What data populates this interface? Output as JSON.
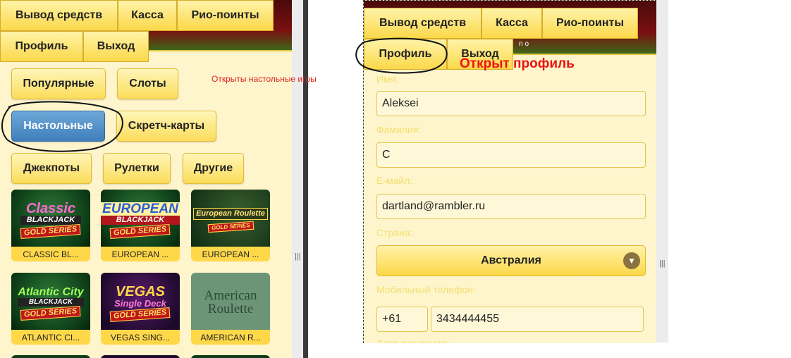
{
  "left": {
    "header": {
      "row1": [
        "Вывод средств",
        "Касса",
        "Рио-поинты"
      ],
      "row2": [
        "Профиль",
        "Выход"
      ],
      "logo_fragment": "no"
    },
    "categories": [
      "Популярные",
      "Слоты",
      "Настольные",
      "Скретч-карты",
      "Джекпоты",
      "Рулетки",
      "Другие"
    ],
    "active_category": "Настольные",
    "games": [
      {
        "caption": "CLASSIC BL...",
        "logo_top": "Classic",
        "logo_mid": "BLACKJACK",
        "badge": "GOLD SERIES",
        "icon": "classic-blackjack-thumbnail-icon"
      },
      {
        "caption": "EUROPEAN ...",
        "logo_top": "EUROPEAN",
        "logo_mid": "BLACKJACK",
        "badge": "GOLD SERIES",
        "icon": "european-blackjack-thumbnail-icon"
      },
      {
        "caption": "EUROPEAN ...",
        "logo_top": "European Roulette",
        "logo_mid": "",
        "badge": "GOLD SERIES",
        "icon": "european-roulette-thumbnail-icon"
      },
      {
        "caption": "ATLANTIC CI...",
        "logo_top": "Atlantic City",
        "logo_mid": "BLACKJACK",
        "badge": "GOLD SERIES",
        "icon": "atlantic-city-blackjack-thumbnail-icon"
      },
      {
        "caption": "VEGAS SING...",
        "logo_top": "VEGAS",
        "logo_mid": "Single Deck",
        "badge": "GOLD SERIES",
        "icon": "vegas-single-deck-thumbnail-icon"
      },
      {
        "caption": "AMERICAN R...",
        "logo_top": "American",
        "logo_mid": "Roulette",
        "badge": "",
        "icon": "american-roulette-thumbnail-icon"
      }
    ]
  },
  "annotations": {
    "left_note": "Открыты настольные игры",
    "right_note_1": "Открыт",
    "right_note_2": "профиль"
  },
  "right": {
    "header": {
      "row1": [
        "Вывод средств",
        "Касса",
        "Рио-поинты"
      ],
      "row2": [
        "Профиль",
        "Выход"
      ],
      "logo_fragment": "no"
    },
    "form": {
      "first_name_label": "Имя:",
      "first_name": "Aleksei",
      "last_name_label": "Фамилия:",
      "last_name": "C",
      "email_label": "E-майл:",
      "email": "dartland@rambler.ru",
      "country_label": "Страна:",
      "country": "Австралия",
      "phone_label": "Мобильный телефон:",
      "phone_code": "+61",
      "phone_number": "3434444455",
      "next_label_partial": "Дата рождения:"
    }
  },
  "colors": {
    "panel_bg": "#fff5cc",
    "button_gold": "#fbd84a",
    "active_blue": "#3f7fbc",
    "annotation_red": "#ee1111"
  }
}
